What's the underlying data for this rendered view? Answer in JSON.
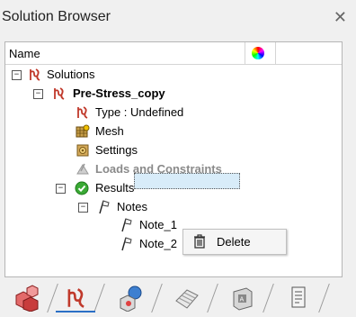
{
  "window": {
    "title": "Solution Browser"
  },
  "header": {
    "name_col": "Name"
  },
  "tree": {
    "solutions": {
      "label": "Solutions",
      "expander": "−"
    },
    "prestress": {
      "label": "Pre-Stress_copy",
      "expander": "−"
    },
    "type": {
      "label": "Type : Undefined"
    },
    "mesh": {
      "label": "Mesh"
    },
    "settings": {
      "label": "Settings"
    },
    "loads": {
      "label": "Loads and Constraints"
    },
    "results": {
      "label": "Results",
      "expander": "−"
    },
    "notes": {
      "label": "Notes",
      "expander": "−"
    },
    "note1": {
      "label": "Note_1"
    },
    "note2": {
      "label": "Note_2"
    }
  },
  "context_menu": {
    "delete_label": "Delete"
  },
  "colors": {
    "selection": "#d8ecf9",
    "accent": "#2b6fc5",
    "results_green": "#3aa935",
    "solution_red": "#c0392b"
  }
}
